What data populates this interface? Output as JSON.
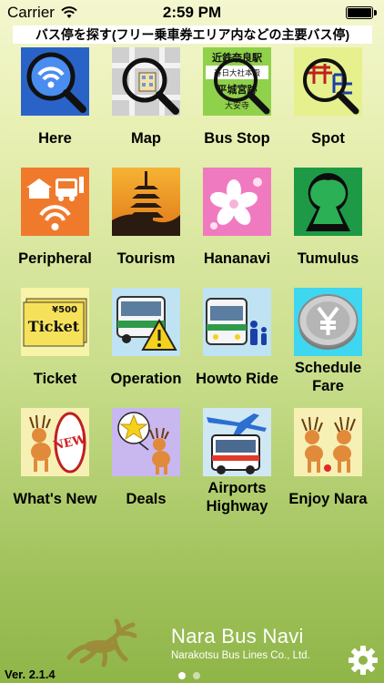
{
  "status_bar": {
    "carrier": "Carrier",
    "time": "2:59 PM"
  },
  "banner": {
    "text": "バス停を探す(フリー乗車券エリア内などの主要バス停)"
  },
  "grid": {
    "tiles": [
      {
        "label": "Here",
        "icon": "wifi-magnifier-icon"
      },
      {
        "label": "Map",
        "icon": "map-magnifier-icon"
      },
      {
        "label": "Bus Stop",
        "icon": "bus-stop-sign-icon",
        "sign_lines": [
          "近鉄奈良駅",
          "春日大社本殿",
          "平城宮跡",
          "大安寺"
        ]
      },
      {
        "label": "Spot",
        "icon": "spot-map-symbols-icon"
      },
      {
        "label": "Peripheral",
        "icon": "peripheral-icon"
      },
      {
        "label": "Tourism",
        "icon": "pagoda-icon"
      },
      {
        "label": "Hananavi",
        "icon": "sakura-flower-icon"
      },
      {
        "label": "Tumulus",
        "icon": "keyhole-tumulus-icon"
      },
      {
        "label": "Ticket",
        "icon": "ticket-icon",
        "ticket_price": "¥500",
        "ticket_text": "Ticket"
      },
      {
        "label": "Operation",
        "icon": "bus-warning-icon"
      },
      {
        "label": "Howto Ride",
        "icon": "bus-passengers-icon"
      },
      {
        "label": "Schedule\nFare",
        "icon": "yen-coin-icon",
        "label_lines": [
          "Schedule",
          "Fare"
        ]
      },
      {
        "label": "What's New",
        "icon": "deer-new-icon",
        "new_text": "NEW"
      },
      {
        "label": "Deals",
        "icon": "star-deer-icon"
      },
      {
        "label": "Airports\nHighway",
        "icon": "airport-bus-icon",
        "label_lines": [
          "Airports",
          "Highway"
        ]
      },
      {
        "label": "Enjoy Nara",
        "icon": "deer-pair-icon"
      }
    ]
  },
  "footer": {
    "app_name": "Nara Bus Navi",
    "company": "Narakotsu Bus Lines Co., Ltd.",
    "version": "Ver. 2.1.4",
    "page_count": 2,
    "active_page": 1
  },
  "colors": {
    "accent_green": "#9fc15a",
    "banner_bg": "#ffffff"
  }
}
